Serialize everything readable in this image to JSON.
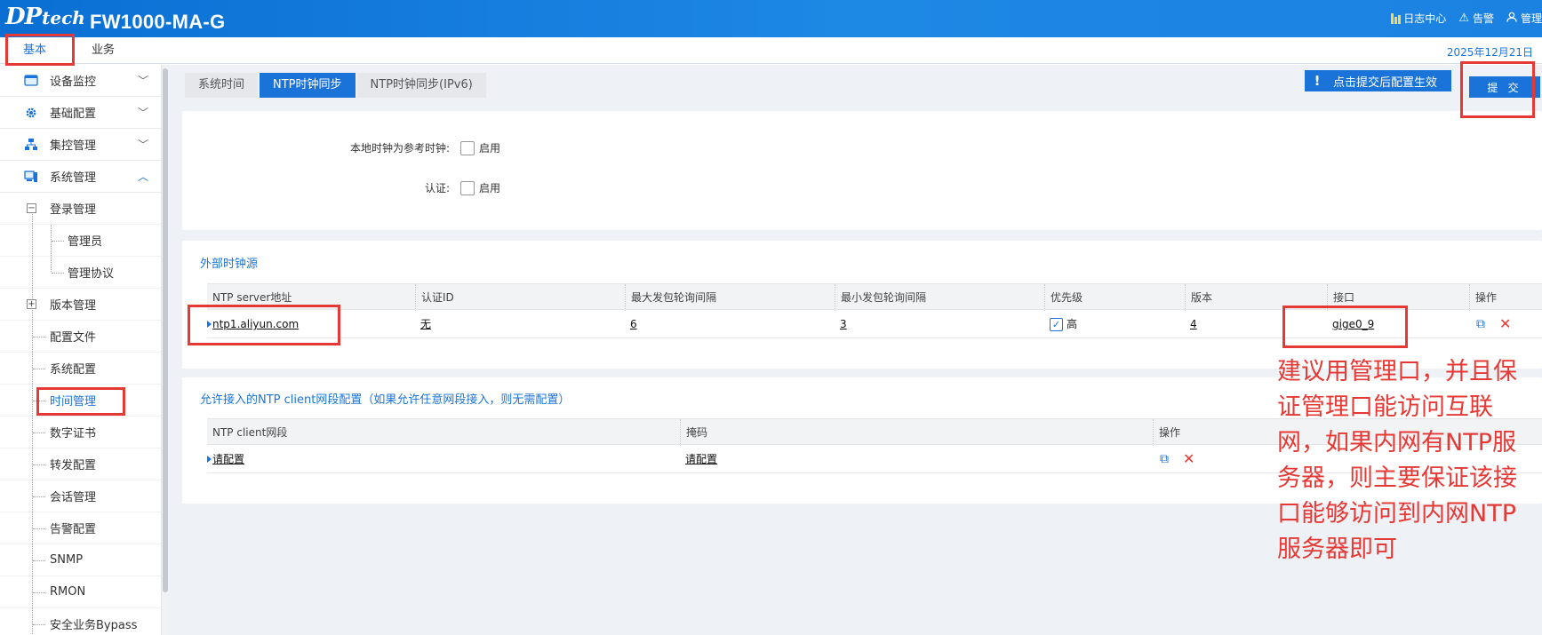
{
  "app": {
    "logo_dp": "DP",
    "logo_tech": "tech",
    "product": "FW1000-MA-G",
    "top_actions": [
      "日志中心",
      "告警",
      "管理"
    ],
    "date": "2025年12月21日"
  },
  "main_tabs": [
    "基本",
    "业务"
  ],
  "sidebar": {
    "groups": [
      {
        "label": "设备监控",
        "icon": "monitor-icon",
        "open": false
      },
      {
        "label": "基础配置",
        "icon": "gear-icon",
        "open": false
      },
      {
        "label": "集控管理",
        "icon": "network-icon",
        "open": false
      },
      {
        "label": "系统管理",
        "icon": "computer-icon",
        "open": true
      }
    ],
    "items": [
      {
        "label": "登录管理",
        "level": 1,
        "expander": "−"
      },
      {
        "label": "管理员",
        "level": 2
      },
      {
        "label": "管理协议",
        "level": 2
      },
      {
        "label": "版本管理",
        "level": 1,
        "expander": "+"
      },
      {
        "label": "配置文件",
        "level": 1
      },
      {
        "label": "系统配置",
        "level": 1
      },
      {
        "label": "时间管理",
        "level": 1,
        "active": true
      },
      {
        "label": "数字证书",
        "level": 1
      },
      {
        "label": "转发配置",
        "level": 1
      },
      {
        "label": "会话管理",
        "level": 1
      },
      {
        "label": "告警配置",
        "level": 1
      },
      {
        "label": "SNMP",
        "level": 1
      },
      {
        "label": "RMON",
        "level": 1
      },
      {
        "label": "安全业务Bypass",
        "level": 1
      }
    ]
  },
  "subtabs": [
    "系统时间",
    "NTP时钟同步",
    "NTP时钟同步(IPv6)"
  ],
  "notice": "点击提交后配置生效",
  "submit_label": "提 交",
  "form": {
    "local_ref_label": "本地时钟为参考时钟:",
    "local_ref_caption": "启用",
    "auth_label": "认证:",
    "auth_caption": "启用"
  },
  "external": {
    "title": "外部时钟源",
    "headers": [
      "NTP server地址",
      "认证ID",
      "最大发包轮询间隔",
      "最小发包轮询间隔",
      "优先级",
      "版本",
      "接口",
      "操作"
    ],
    "row": {
      "server": "ntp1.aliyun.com",
      "auth_id": "无",
      "max_interval": "6",
      "min_interval": "3",
      "priority": "高",
      "version": "4",
      "interface": "gige0_9"
    }
  },
  "clients": {
    "title": "允许接入的NTP client网段配置（如果允许任意网段接入，则无需配置）",
    "headers": [
      "NTP client网段",
      "掩码",
      "操作"
    ],
    "row": {
      "segment": "请配置",
      "mask": "请配置"
    }
  },
  "annotation": "建议用管理口，并且保证管理口能访问互联网，如果内网有NTP服务器，则主要保证该接口能够访问到内网NTP服务器即可",
  "colors": {
    "accent": "#1a73d9",
    "highlight": "#e53935"
  }
}
